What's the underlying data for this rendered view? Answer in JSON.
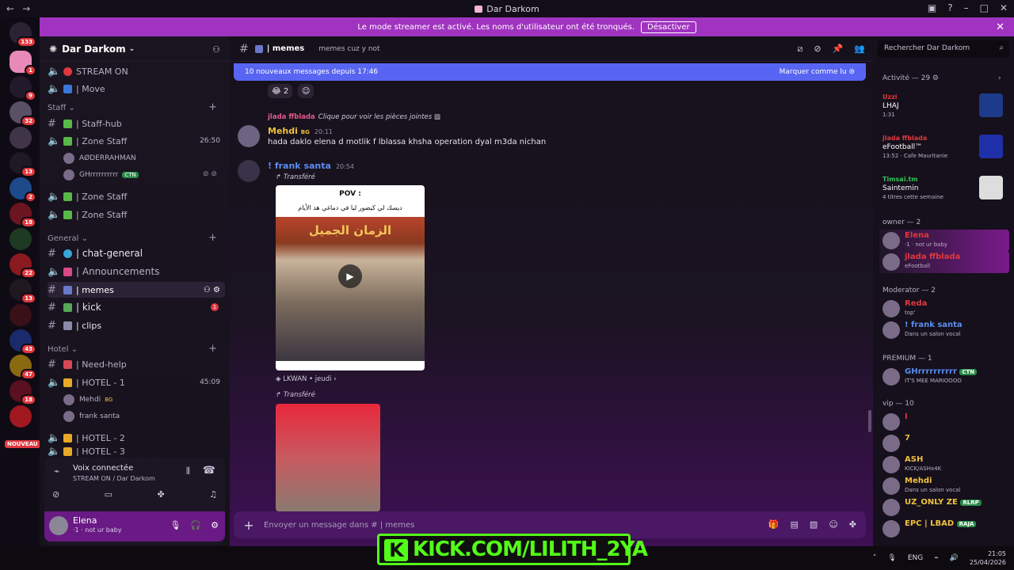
{
  "window": {
    "title": "Dar Darkom",
    "back": "←",
    "forward": "→"
  },
  "rail_badges": [
    "133",
    "1",
    "9",
    "32",
    "13",
    "2",
    "18",
    "22",
    "13",
    "43",
    "47",
    "18"
  ],
  "rail_new": "NOUVEAU",
  "banner": {
    "text": "Le mode streamer est activé. Les noms d'utilisateur ont été tronqués.",
    "button": "Désactiver"
  },
  "guild": {
    "name": "Dar Darkom"
  },
  "channels": {
    "stream_on": "STREAM ON",
    "move": "| Move",
    "cat_staff": "Staff",
    "staff_hub": "| Staff-hub",
    "zone_staff_1": "| Zone Staff",
    "zone_staff_1_time": "26:50",
    "voice_user_1": "AØDERRAHMAN",
    "voice_user_2": "GHrrrrrrrrrr",
    "voice_user_2_tag": "CTN",
    "zone_staff_2": "| Zone Staff",
    "zone_staff_3": "| Zone Staff",
    "cat_general": "General",
    "chat_general": "| chat-general",
    "announcements": "| Announcements",
    "memes": "| memes",
    "kick": "| kick",
    "kick_badge": "1",
    "clips": "| clips",
    "cat_hotel": "Hotel",
    "need_help": "| Need-help",
    "hotel1": "| HOTEL - 1",
    "hotel1_time": "45:09",
    "hotel_user_1": "Mehdi",
    "hotel_user_1_tag": "BG",
    "hotel_user_2": "frank santa",
    "hotel2": "| HOTEL - 2",
    "hotel3": "| HOTEL - 3"
  },
  "voice": {
    "status": "Voix connectée",
    "location": "STREAM ON / Dar Darkom"
  },
  "user": {
    "name": "Elena",
    "status": "·1 · not ur baby"
  },
  "chat": {
    "channel": "| memes",
    "topic": "memes cuz y not",
    "new_messages": "10 nouveaux messages depuis 17:46",
    "mark_read": "Marquer comme lu",
    "reaction_count": "2",
    "reply_name": "jlada ffblada",
    "reply_text": "Clique pour voir les pièces jointes",
    "msg1_name": "Mehdi",
    "msg1_tag": "BG",
    "msg1_time": "20:11",
    "msg1_text": "hada daklo elena d motlik f lblassa khsha operation dyal m3da nichan",
    "msg2_name": "! frank santa",
    "msg2_time": "20:54",
    "forwarded": "Transféré",
    "embed_pov": "POV :",
    "embed_arabic": "ديسك لي كيضور ليا في دماغي هد الأيام",
    "embed_title": "الزمان الجميل",
    "source": "LKWAN • jeudi",
    "forwarded2": "Transféré",
    "composer_placeholder": "Envoyer un message dans # | memes"
  },
  "members": {
    "search": "Rechercher Dar Darkom",
    "activity_header": "Activité — 29",
    "activities": [
      {
        "name": "Uzzi",
        "game": "LHAJ",
        "detail": "1:31",
        "color": "#e0383e",
        "thumb": "#1e3a8a"
      },
      {
        "name": "jlada ffblada",
        "game": "eFootball™",
        "detail": "13:52 · Cafe Mauritanie",
        "color": "#e0383e",
        "thumb": "#1f2fa8"
      },
      {
        "name": "Timsaï.tm",
        "game": "Saintemin",
        "detail": "4 titres cette semaine",
        "color": "#36c25a",
        "thumb": "#dddddd"
      }
    ],
    "role_owner": "owner — 2",
    "owners": [
      {
        "name": "Elena",
        "status": "·1 · not ur baby",
        "color": "#e0383e"
      },
      {
        "name": "jlada ffblada",
        "status": "eFootball",
        "color": "#e0383e"
      }
    ],
    "role_mod": "Moderator — 2",
    "mods": [
      {
        "name": "Reda",
        "status": "top'",
        "color": "#e0383e"
      },
      {
        "name": "! frank santa",
        "status": "Dans un salon vocal",
        "color": "#5b8def"
      }
    ],
    "role_premium": "PREMIUM — 1",
    "premium": [
      {
        "name": "GHrrrrrrrrrr",
        "status": "IT'S MEE MARIOOOO",
        "color": "#5b8def",
        "tag": "CTN"
      }
    ],
    "role_vip": "vip — 10",
    "vips": [
      {
        "name": "I",
        "status": "",
        "color": "#e0383e"
      },
      {
        "name": "7",
        "status": "",
        "color": "#f0c040"
      },
      {
        "name": "ASH",
        "status": "KICK/ASHx4K",
        "color": "#f0c040"
      },
      {
        "name": "Mehdi",
        "status": "Dans un salon vocal",
        "color": "#f0c040"
      },
      {
        "name": "UZ_ONLY ZE",
        "status": "",
        "color": "#f0c040",
        "tag": "RLRP"
      },
      {
        "name": "EPC | LBAD",
        "status": "",
        "color": "#f0c040",
        "tag": "RAJA"
      }
    ]
  },
  "overlay": {
    "kick": "KICK.COM/LILITH_2YA"
  },
  "tray": {
    "lang": "ENG",
    "time": "21:05",
    "date": "25/04/2026"
  }
}
